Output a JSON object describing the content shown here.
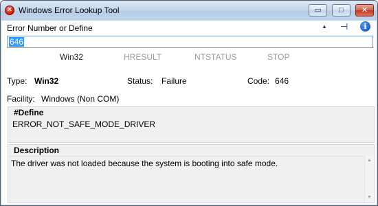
{
  "window": {
    "title": "Windows Error Lookup Tool",
    "min_glyph": "▭",
    "max_glyph": "□",
    "close_glyph": "✕",
    "app_icon_glyph": "✕"
  },
  "toolbar": {
    "up_glyph": "▲",
    "pin_glyph": "⊣",
    "info_glyph": "i"
  },
  "input": {
    "label": "Error Number or Define",
    "value": "646"
  },
  "tabs": [
    {
      "label": "Win32",
      "active": true
    },
    {
      "label": "HRESULT",
      "active": false
    },
    {
      "label": "NTSTATUS",
      "active": false
    },
    {
      "label": "STOP",
      "active": false
    }
  ],
  "details": {
    "type_label": "Type:",
    "type_value": "Win32",
    "status_label": "Status:",
    "status_value": "Failure",
    "code_label": "Code:",
    "code_value": "646",
    "facility_label": "Facility:",
    "facility_value": "Windows (Non COM)"
  },
  "define": {
    "heading": "#Define",
    "value": "ERROR_NOT_SAFE_MODE_DRIVER"
  },
  "description": {
    "heading": "Description",
    "text": "The driver was not loaded because the system is booting into safe mode."
  },
  "scrollbar": {
    "up_glyph": "▲",
    "down_glyph": "▼"
  },
  "colors": {
    "selection": "#3399ff",
    "title_gradient_top": "#dbe7f4",
    "close_button": "#c0391f",
    "inactive_tab": "#9a9a9a"
  }
}
